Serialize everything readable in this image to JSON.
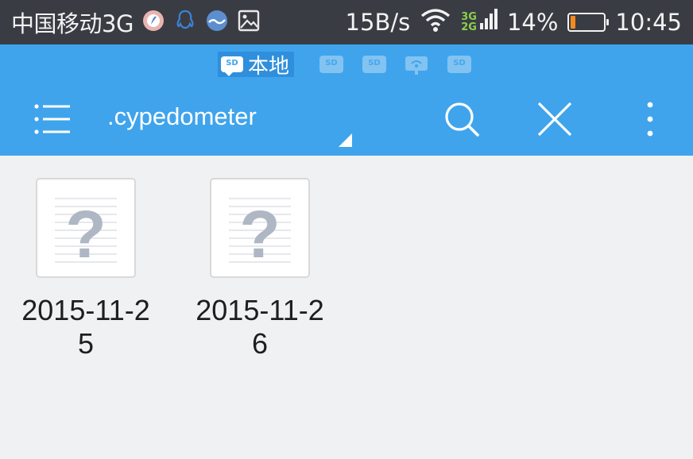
{
  "status_bar": {
    "carrier": "中国移动3G",
    "net_speed": "15B/s",
    "net_type_top": "3G",
    "net_type_bottom": "2G",
    "battery_percent": "14%",
    "battery_level": 0.14,
    "time": "10:45",
    "icons": [
      "app-icon",
      "qq-icon",
      "weather-icon",
      "image-icon",
      "wifi-icon",
      "signal-icon",
      "battery-icon"
    ]
  },
  "header": {
    "storage_tabs": {
      "active_label": "本地",
      "chip_text": "SD"
    },
    "path_title": ".cypedometer"
  },
  "files": [
    {
      "name": "2015-11-25",
      "icon": "unknown-file-icon"
    },
    {
      "name": "2015-11-26",
      "icon": "unknown-file-icon"
    }
  ],
  "colors": {
    "status_bar": "#3a3c44",
    "header": "#3fa4ec",
    "background": "#f0f1f3",
    "battery_fill": "#f58b1f",
    "net_badge": "#8bd14a"
  }
}
